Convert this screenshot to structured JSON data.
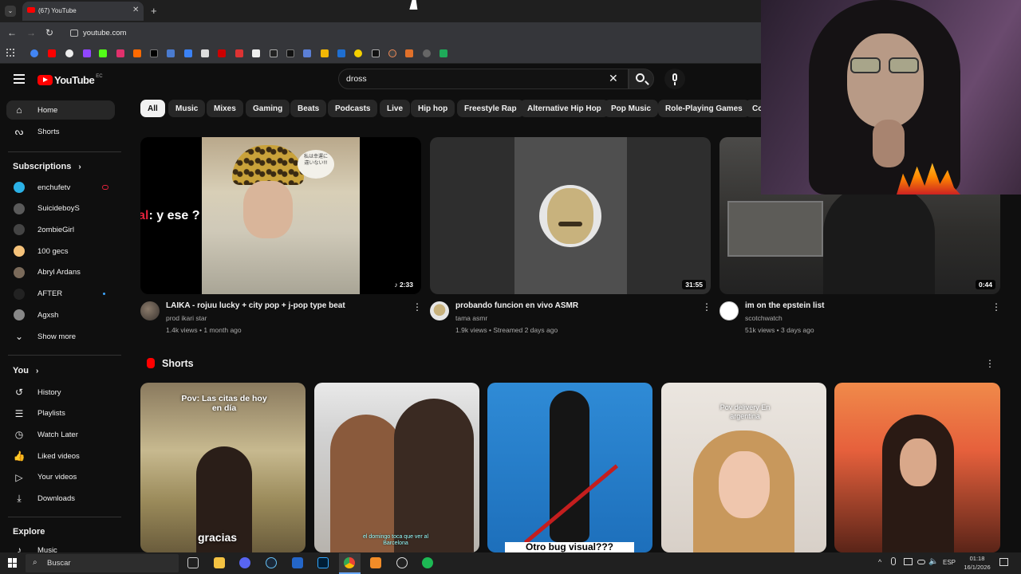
{
  "browser": {
    "tab_title": "(67) YouTube",
    "url": "youtube.com",
    "new_tab": "+"
  },
  "youtube": {
    "logo_text": "YouTube",
    "logo_region": "EC",
    "search_value": "dross",
    "chips": [
      "All",
      "Music",
      "Mixes",
      "Gaming",
      "Beats",
      "Podcasts",
      "Live",
      "Hip hop",
      "Freestyle Rap",
      "Alternative Hip Hop",
      "Pop Music",
      "Role-Playing Games",
      "Co"
    ]
  },
  "sidebar": {
    "home": "Home",
    "shorts": "Shorts",
    "subscriptions_title": "Subscriptions",
    "subs": [
      "enchufetv",
      "SuicideboyS",
      "2ombieGirl",
      "100 gecs",
      "Abryl Ardans",
      "AFTER",
      "Agxsh"
    ],
    "show_more": "Show more",
    "you_title": "You",
    "you_items": [
      "History",
      "Playlists",
      "Watch Later",
      "Liked videos",
      "Your videos",
      "Downloads"
    ],
    "explore_title": "Explore",
    "explore_items": [
      "Music"
    ]
  },
  "videos": [
    {
      "title": "LAIKA - rojuu lucky + city pop + j-pop type beat",
      "channel": "prod ikari star",
      "meta": "1.4k views • 1 month ago",
      "duration": "2:33"
    },
    {
      "title": "probando funcion en vivo ASMR",
      "channel": "tama asmr",
      "meta": "1.9k views • Streamed 2 days ago",
      "duration": "31:55"
    },
    {
      "title": "im on the epstein list",
      "channel": "scotchwatch",
      "meta": "51k views • 3 days ago",
      "duration": "0:44"
    }
  ],
  "overlay_chat": {
    "user": "visivo_oficial",
    "message": ": y ese ?"
  },
  "thumb1_caption": "私は幸運に違いない!!!",
  "shorts": {
    "title": "Shorts",
    "captions": [
      "Pov: Las citas de hoy en día",
      "gracias",
      "el domingo toca que ver al Barcelona",
      "Otro bug visual???",
      "Pov delivery En argentina"
    ]
  },
  "taskbar": {
    "search": "Buscar",
    "lang": "ESP",
    "time": "01:18",
    "date": "16/1/2026"
  },
  "colors": {
    "yt_red": "#ff0000",
    "bg": "#0f0f0f",
    "chip": "#272727"
  }
}
